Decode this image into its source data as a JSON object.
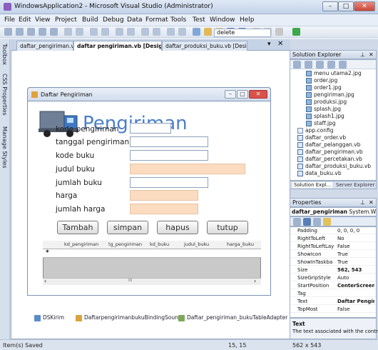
{
  "window": {
    "title": "WindowsApplication2 - Microsoft Visual Studio (Administrator)"
  },
  "menu": [
    "File",
    "Edit",
    "View",
    "Project",
    "Build",
    "Debug",
    "Data",
    "Format",
    "Tools",
    "Test",
    "Window",
    "Help"
  ],
  "toolbar2": {
    "search_value": "delete"
  },
  "doc_tabs": [
    "daftar_pengiriman.vb",
    "daftar pengiriman.vb [Design]",
    "daftar_produksi_buku.vb [Design]"
  ],
  "side_tabs": [
    "Toolbox",
    "CSS Properties",
    "Manage Styles"
  ],
  "form": {
    "title": "Daftar Pengiriman",
    "header": "Pengiriman",
    "labels": [
      "kode pengiriman",
      "tanggal pengiriman",
      "kode buku",
      "judul buku",
      "jumlah buku",
      "harga",
      "jumlah harga"
    ],
    "buttons": [
      "Tambah",
      "simpan",
      "hapus",
      "tutup"
    ],
    "grid_columns": [
      "kd_pengiriman",
      "tg_pengiriman",
      "kd_buku",
      "judul_buku",
      "harga_buku"
    ],
    "grid_marker": "*",
    "scroll_thumb": "III"
  },
  "tray": [
    "DSKirim",
    "DaftarpengirimanbukuBindingSource",
    "Daftar_pengiriman_bukuTableAdapter"
  ],
  "solution_explorer": {
    "title": "Solution Explorer",
    "items": [
      "menu utama2.jpg",
      "order.jpg",
      "order1.jpg",
      "pengiriman.jpg",
      "produksi.jpg",
      "splash.jpg",
      "splash1.jpg",
      "staff.jpg",
      "app.config",
      "daftar_order.vb",
      "daftar_pelanggan.vb",
      "daftar_pengiriman.vb",
      "daftar_percetakan.vb",
      "daftar_produksi_buku.vb",
      "data_buku.vb"
    ],
    "tabs": [
      "Solution Expl...",
      "Server Explorer"
    ]
  },
  "properties": {
    "title": "Properties",
    "object": "daftar_pengiriman",
    "object_type": "System.Windo",
    "rows": [
      {
        "name": "Padding",
        "value": "0, 0, 0, 0"
      },
      {
        "name": "RightToLeft",
        "value": "No"
      },
      {
        "name": "RightToLeftLay",
        "value": "False"
      },
      {
        "name": "ShowIcon",
        "value": "True"
      },
      {
        "name": "ShowInTaskba",
        "value": "True"
      },
      {
        "name": "Size",
        "value": "562, 543"
      },
      {
        "name": "SizeGripStyle",
        "value": "Auto"
      },
      {
        "name": "StartPosition",
        "value": "CenterScreen"
      },
      {
        "name": "Tag",
        "value": ""
      },
      {
        "name": "Text",
        "value": "Daftar Pengirin"
      },
      {
        "name": "TopMost",
        "value": "False"
      }
    ],
    "desc_title": "Text",
    "desc_body": "The text associated with the control."
  },
  "status": {
    "left": "Item(s) Saved",
    "pos": "15, 15",
    "size": "562 x 543"
  },
  "colors": {
    "accent": "#2f6fbf",
    "header_text": "#4a7fc8",
    "readonly_input": "#fbdcc0"
  }
}
